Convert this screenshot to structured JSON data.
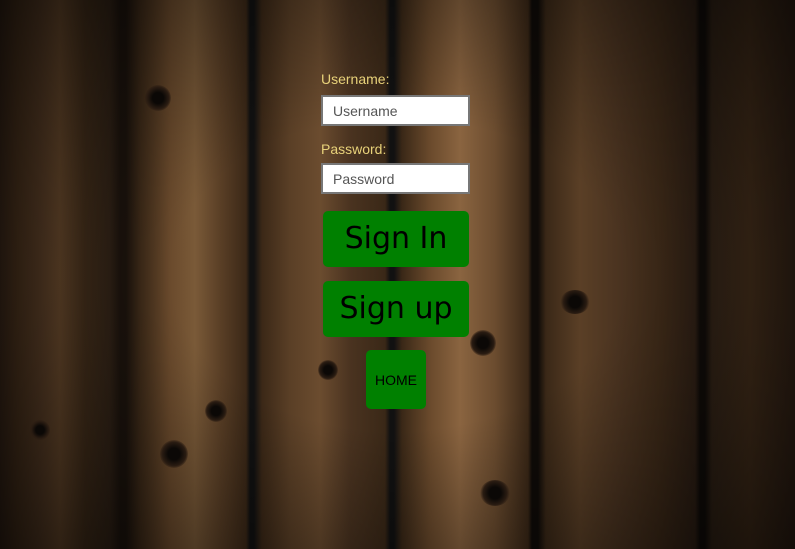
{
  "login_form": {
    "username_label": "Username:",
    "username_placeholder": "Username",
    "username_value": "",
    "password_label": "Password:",
    "password_placeholder": "Password",
    "password_value": "",
    "signin_label": "Sign In",
    "signup_label": "Sign up",
    "home_label": "HOME"
  },
  "colors": {
    "button_bg": "#008000",
    "label_text": "#e8d27a",
    "button_text": "#000000"
  }
}
